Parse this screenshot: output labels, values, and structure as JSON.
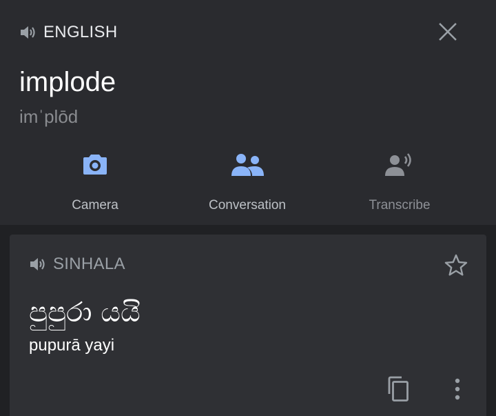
{
  "source": {
    "language": "ENGLISH",
    "word": "implode",
    "phonetic": "imˈplōd"
  },
  "tools": [
    {
      "label": "Camera",
      "icon": "camera-icon"
    },
    {
      "label": "Conversation",
      "icon": "conversation-icon"
    },
    {
      "label": "Transcribe",
      "icon": "transcribe-icon"
    }
  ],
  "result": {
    "language": "SINHALA",
    "translation": "පුපුරා යයි",
    "transliteration": "pupurā yayi"
  },
  "icons": {
    "speaker": "speaker-icon",
    "close": "close-icon",
    "star": "star-outline-icon",
    "copy": "copy-icon",
    "more": "more-vert-icon"
  },
  "colors": {
    "background": "#202124",
    "panel": "#2a2b2f",
    "card": "#2f3034",
    "accent_blue": "#8ab4f8",
    "icon_grey": "#9aa0a6"
  }
}
